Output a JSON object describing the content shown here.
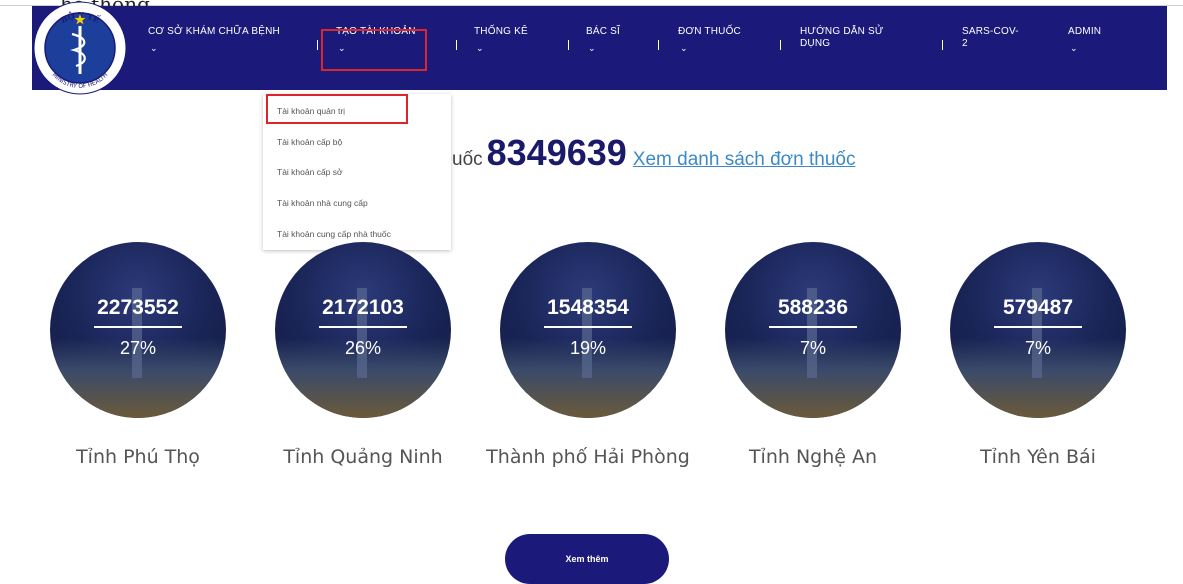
{
  "top_caption": "hệ thống",
  "logo": {
    "ring_text_top": "BỘ Y TẾ",
    "ring_text_bottom": "MINISTRY OF HEALTH"
  },
  "nav": [
    {
      "label": "CƠ SỞ KHÁM CHỮA BỆNH"
    },
    {
      "label": "TẠO TÀI KHOẢN"
    },
    {
      "label": "THỐNG KÊ"
    },
    {
      "label": "BÁC SĨ"
    },
    {
      "label": "ĐƠN THUỐC"
    },
    {
      "label_line1": "HƯỚNG DẪN SỬ",
      "label_line2": "DỤNG"
    },
    {
      "label_line1": "SARS-COV-",
      "label_line2": "2"
    },
    {
      "label": "ADMIN"
    }
  ],
  "dropdown": [
    "Tài khoản quản trị",
    "Tài khoản cấp bộ",
    "Tài khoản cấp sở",
    "Tài khoản nhà cung cấp",
    "Tài khoản cung cấp nhà thuốc"
  ],
  "headline": {
    "prefix": "uốc",
    "count": "8349639",
    "link": "Xem danh sách đơn thuốc"
  },
  "provinces": [
    {
      "value": "2273552",
      "pct": "27%",
      "name": "Tỉnh Phú Thọ"
    },
    {
      "value": "2172103",
      "pct": "26%",
      "name": "Tỉnh Quảng Ninh"
    },
    {
      "value": "1548354",
      "pct": "19%",
      "name": "Thành phố Hải Phòng"
    },
    {
      "value": "588236",
      "pct": "7%",
      "name": "Tỉnh Nghệ An"
    },
    {
      "value": "579487",
      "pct": "7%",
      "name": "Tỉnh Yên Bái"
    }
  ],
  "more_button": "Xem thêm",
  "colors": {
    "navbar": "#1b1a7a",
    "highlight": "#d9262c",
    "link": "#3a8ac8"
  }
}
